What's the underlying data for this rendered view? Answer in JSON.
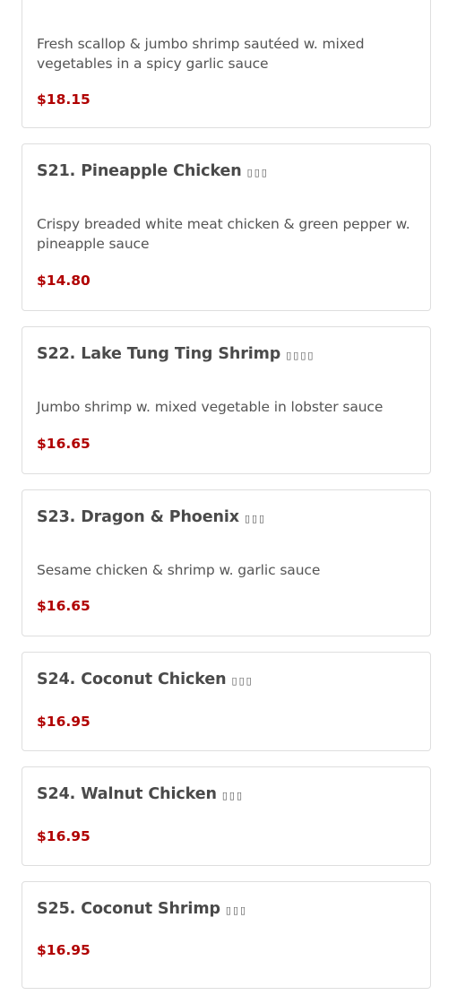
{
  "items": [
    {
      "title": "",
      "chinese": "",
      "description": "Fresh scallop & jumbo shrimp sautéed w. mixed vegetables in a spicy garlic sauce",
      "price": "$18.15",
      "spicy_icon": "hot-pepper-icon"
    },
    {
      "title": "S21. Pineapple Chicken",
      "chinese": "▯▯▯",
      "description": "Crispy breaded white meat chicken & green pepper w. pineapple sauce",
      "price": "$14.80"
    },
    {
      "title": "S22. Lake Tung Ting Shrimp",
      "chinese": "▯▯▯▯",
      "description": "Jumbo shrimp w. mixed vegetable in lobster sauce",
      "price": "$16.65"
    },
    {
      "title": "S23. Dragon & Phoenix",
      "chinese": "▯▯▯",
      "description": "Sesame chicken & shrimp w. garlic sauce",
      "price": "$16.65"
    },
    {
      "title": "S24. Coconut Chicken",
      "chinese": "▯▯▯",
      "price": "$16.95"
    },
    {
      "title": "S24. Walnut Chicken",
      "chinese": "▯▯▯",
      "price": "$16.95"
    },
    {
      "title": "S25. Coconut Shrimp",
      "chinese": "▯▯▯",
      "price": "$16.95"
    }
  ]
}
